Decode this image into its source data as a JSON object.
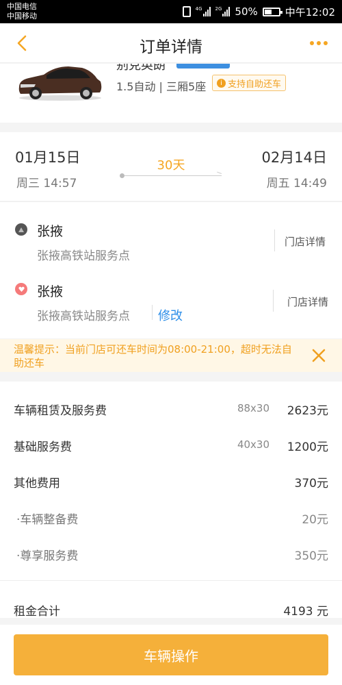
{
  "status_bar": {
    "carrier_1": "中国电信",
    "carrier_2": "中国移动",
    "net_1": "4G",
    "net_2": "2G",
    "battery_percent": "50%",
    "battery_level": 0.5,
    "time": "中午12:02"
  },
  "nav": {
    "title": "订单详情",
    "back_icon": "chevron-left-icon",
    "more_icon": "more-dots-icon",
    "accent_color": "#f5a623"
  },
  "car": {
    "name": "别克英朗",
    "spec": "1.5自动 | 三厢5座",
    "self_return_badge": "支持自助还车",
    "body_color": "#4a2e22"
  },
  "rental": {
    "pickup_date": "01月15日",
    "pickup_time": "周三 14:57",
    "duration": "30天",
    "return_date": "02月14日",
    "return_time": "周五 14:49"
  },
  "pickup_store": {
    "city": "张掖",
    "name": "张掖高铁站服务点",
    "detail_link": "门店详情",
    "icon": "pickup-triangle-icon"
  },
  "return_store": {
    "city": "张掖",
    "name": "张掖高铁站服务点",
    "modify_link": "修改",
    "detail_link": "门店详情",
    "icon": "return-heart-icon"
  },
  "notice": {
    "text": "温馨提示：当前门店可还车时间为08:00-21:00，超时无法自助还车",
    "close_icon": "close-icon"
  },
  "fees": {
    "rows": [
      {
        "label": "车辆租赁及服务费",
        "qty": "88x30",
        "amount": "2623元"
      },
      {
        "label": "基础服务费",
        "qty": "40x30",
        "amount": "1200元"
      },
      {
        "label": "其他费用",
        "qty": "",
        "amount": "370元"
      },
      {
        "label": "·车辆整备费",
        "qty": "",
        "amount": "20元"
      },
      {
        "label": "·尊享服务费",
        "qty": "",
        "amount": "350元"
      }
    ],
    "total_label": "租金合计",
    "total_amount": "4193 元"
  },
  "action": {
    "button_label": "车辆操作",
    "button_color": "#f5b03a"
  }
}
